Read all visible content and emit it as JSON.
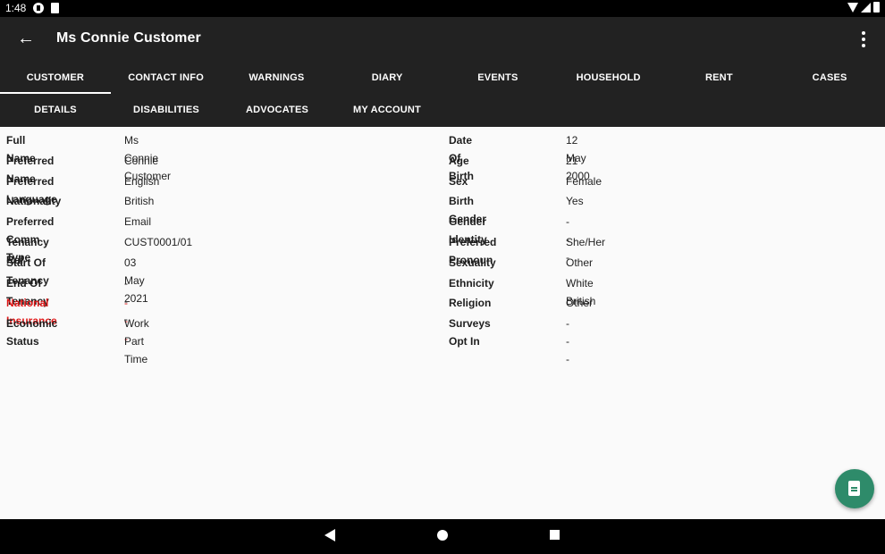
{
  "status_bar": {
    "time": "1:48"
  },
  "app_bar": {
    "title": "Ms Connie Customer"
  },
  "primary_tabs": [
    "CUSTOMER",
    "CONTACT INFO",
    "WARNINGS",
    "DIARY",
    "EVENTS",
    "HOUSEHOLD",
    "RENT",
    "CASES"
  ],
  "secondary_tabs": [
    "DETAILS",
    "DISABILITIES",
    "ADVOCATES",
    "MY ACCOUNT"
  ],
  "details": {
    "left": [
      {
        "label": "Full Name",
        "value": "Ms Connie Customer"
      },
      {
        "label": "Preferred Name",
        "value": "Connie"
      },
      {
        "label": "Preferred Language",
        "value": "English"
      },
      {
        "label": "Nationality",
        "value": "British"
      },
      {
        "label": "Preferred Comm Type",
        "value": "Email"
      },
      {
        "label": "Tenancy Ref",
        "value": "CUST0001/01"
      },
      {
        "label": "Start Of Tenancy",
        "value": "03 May 2021"
      },
      {
        "label": "End Of Tenancy",
        "value": "- - -"
      },
      {
        "label": "National Insurance",
        "value": "- - -"
      },
      {
        "label": "Economic Status",
        "value": "Work Part Time"
      }
    ],
    "right": [
      {
        "label": "Date Of Birth",
        "value": "12 May 2000"
      },
      {
        "label": "Age",
        "value": "21"
      },
      {
        "label": "Sex",
        "value": "Female"
      },
      {
        "label": "Birth Gender",
        "value": "Yes"
      },
      {
        "label": "Gender Identity",
        "value": "- - -"
      },
      {
        "label": "Preferred Pronoun",
        "value": "She/Her"
      },
      {
        "label": "Sexuality",
        "value": "Other"
      },
      {
        "label": "Ethnicity",
        "value": "White British"
      },
      {
        "label": "Religion",
        "value": "Other"
      },
      {
        "label": "Surveys Opt In",
        "value": "- - -"
      }
    ]
  },
  "colors": {
    "alert": "#e01818",
    "fab": "#2e8b6a",
    "app_bar": "#222222"
  }
}
